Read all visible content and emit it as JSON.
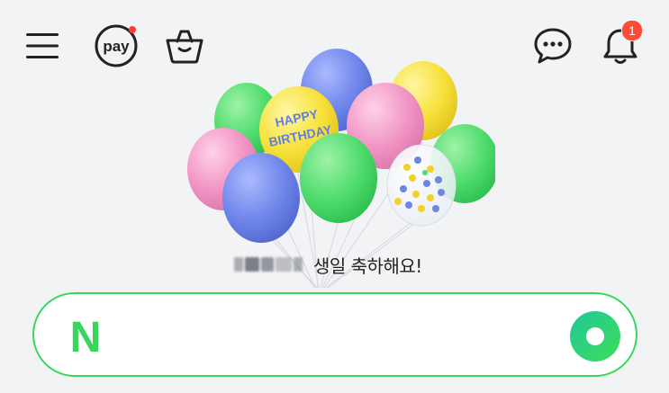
{
  "topbar": {
    "menu_icon": "hamburger-menu-icon",
    "pay_icon": "pay-icon",
    "pay_label": "pay",
    "shopping_icon": "shopping-bag-icon",
    "chat_icon": "chat-bubble-icon",
    "bell_icon": "notification-bell-icon",
    "notification_count": "1"
  },
  "hero": {
    "balloon_text_line1": "HAPPY",
    "balloon_text_line2": "BIRTHDAY",
    "birthday_message": "생일 축하해요!"
  },
  "search": {
    "logo_letter": "N",
    "value": "",
    "action_icon": "green-circle-search-icon"
  },
  "colors": {
    "brand_green": "#39d65c",
    "badge_red": "#ff4a3a",
    "background": "#f2f3f5"
  }
}
